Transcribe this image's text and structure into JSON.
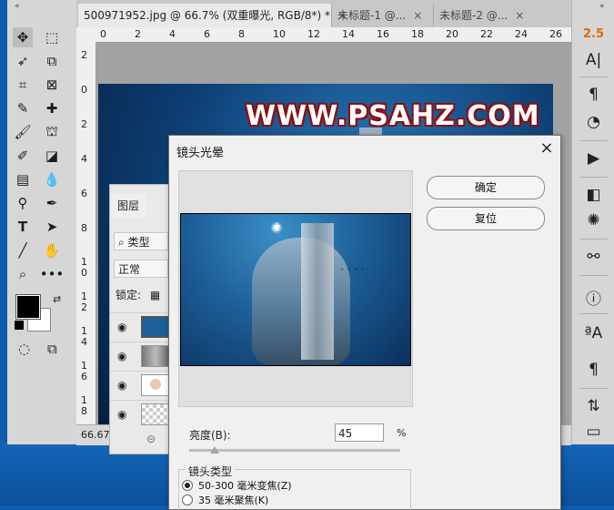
{
  "window": {
    "tabs": [
      {
        "label": "500971952.jpg @ 66.7% (双重曝光, RGB/8*) *",
        "close": "×"
      },
      {
        "label": "未标题-1 @...",
        "close": "×"
      },
      {
        "label": "未标题-2 @...",
        "close": "×"
      }
    ],
    "collapse_left": "«",
    "collapse_right": "«"
  },
  "rulers": {
    "h_ticks": [
      "0",
      "2",
      "4",
      "6",
      "8",
      "10",
      "12",
      "14",
      "16",
      "18",
      "20",
      "22",
      "24",
      "26"
    ],
    "v_ticks": [
      "2",
      "0",
      "2",
      "4",
      "6",
      "8",
      "1\n0",
      "1\n2",
      "1\n4",
      "1\n6",
      "1\n8"
    ]
  },
  "canvas": {
    "watermark": "WWW.PSAHZ.COM"
  },
  "status_bar": {
    "zoom": "66.67%"
  },
  "right_panel": {
    "value": "2.5",
    "icons": [
      "character-icon",
      "paragraph-icon",
      "glyph-icon",
      "play-icon",
      "swatch-book-icon",
      "burst-icon",
      "share-icon",
      "info-icon",
      "char-style-icon",
      "para-style-icon",
      "adjust-icon",
      "layer-comp-icon"
    ]
  },
  "layers_panel": {
    "tab": "图层",
    "filter": "类型",
    "blend_mode": "正常",
    "lock_label": "锁定:",
    "link_icon": "⊝"
  },
  "dialog": {
    "title": "镜头光晕",
    "close": "×",
    "ok_label": "确定",
    "reset_label": "复位",
    "brightness_label": "亮度(B):",
    "brightness_value": "45",
    "percent": "%",
    "lens_type_title": "镜头类型",
    "lens_options": [
      {
        "label": "50-300 毫米变焦(Z)",
        "selected": true
      },
      {
        "label": "35 毫米聚焦(K)",
        "selected": false
      }
    ]
  }
}
